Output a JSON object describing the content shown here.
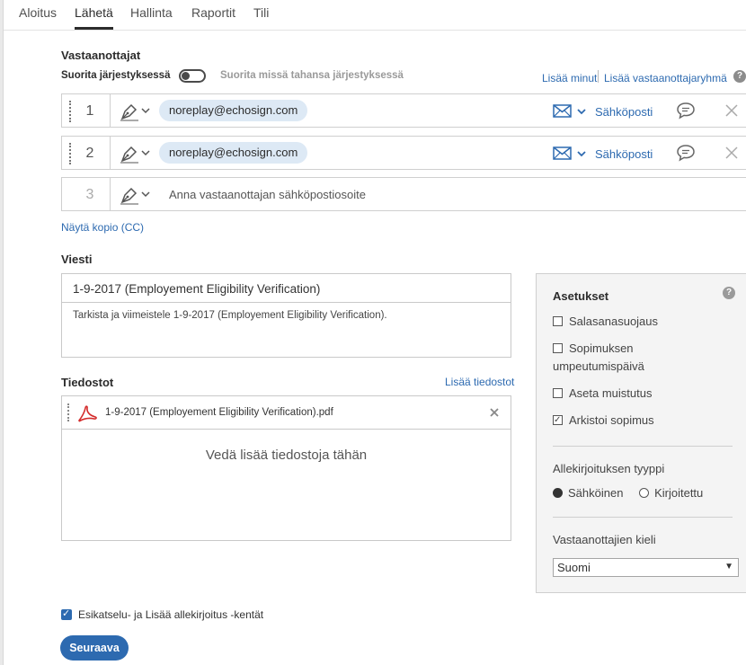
{
  "nav": {
    "tabs": [
      {
        "label": "Aloitus",
        "active": false
      },
      {
        "label": "Lähetä",
        "active": true
      },
      {
        "label": "Hallinta",
        "active": false
      },
      {
        "label": "Raportit",
        "active": false
      },
      {
        "label": "Tili",
        "active": false
      }
    ]
  },
  "recipients": {
    "title": "Vastaanottajat",
    "order_label": "Suorita järjestyksessä",
    "any_order_label": "Suorita missä tahansa järjestyksessä",
    "add_me": "Lisää minut",
    "add_group": "Lisää vastaanottajaryhmä",
    "help": "?",
    "rows": [
      {
        "number": "1",
        "email": "noreplay@echosign.com",
        "delivery": "Sähköposti"
      },
      {
        "number": "2",
        "email": "noreplay@echosign.com",
        "delivery": "Sähköposti"
      }
    ],
    "new_row": {
      "number": "3",
      "placeholder": "Anna vastaanottajan sähköpostiosoite"
    },
    "show_cc": "Näytä kopio (CC)"
  },
  "message": {
    "title": "Viesti",
    "subject": "1-9-2017 (Employement Eligibility Verification)",
    "body": "Tarkista ja viimeistele 1-9-2017 (Employement Eligibility Verification)."
  },
  "files": {
    "title": "Tiedostot",
    "add_files": "Lisää tiedostot",
    "items": [
      {
        "name": "1-9-2017 (Employement Eligibility Verification).pdf"
      }
    ],
    "drop_text": "Vedä lisää tiedostoja tähän"
  },
  "settings": {
    "title": "Asetukset",
    "help": "?",
    "password": {
      "label": "Salasanasuojaus",
      "checked": false
    },
    "expiry_line1": "Sopimuksen",
    "expiry_line2": "umpeutumispäivä",
    "reminder": {
      "label": "Aseta muistutus",
      "checked": false
    },
    "archive": {
      "label": "Arkistoi sopimus",
      "checked": true
    },
    "signature_type_title": "Allekirjoituksen tyyppi",
    "signature_electronic": "Sähköinen",
    "signature_written": "Kirjoitettu",
    "signature_selected": "Sähköinen",
    "language_title": "Vastaanottajien kieli",
    "language_value": "Suomi"
  },
  "footer": {
    "preview_label": "Esikatselu- ja Lisää allekirjoitus -kentät",
    "preview_checked": true,
    "next_button": "Seuraava"
  },
  "colors": {
    "accent": "#2d6ab0",
    "chip_bg": "#dde9f5",
    "panel_bg": "#f4f4f4"
  }
}
